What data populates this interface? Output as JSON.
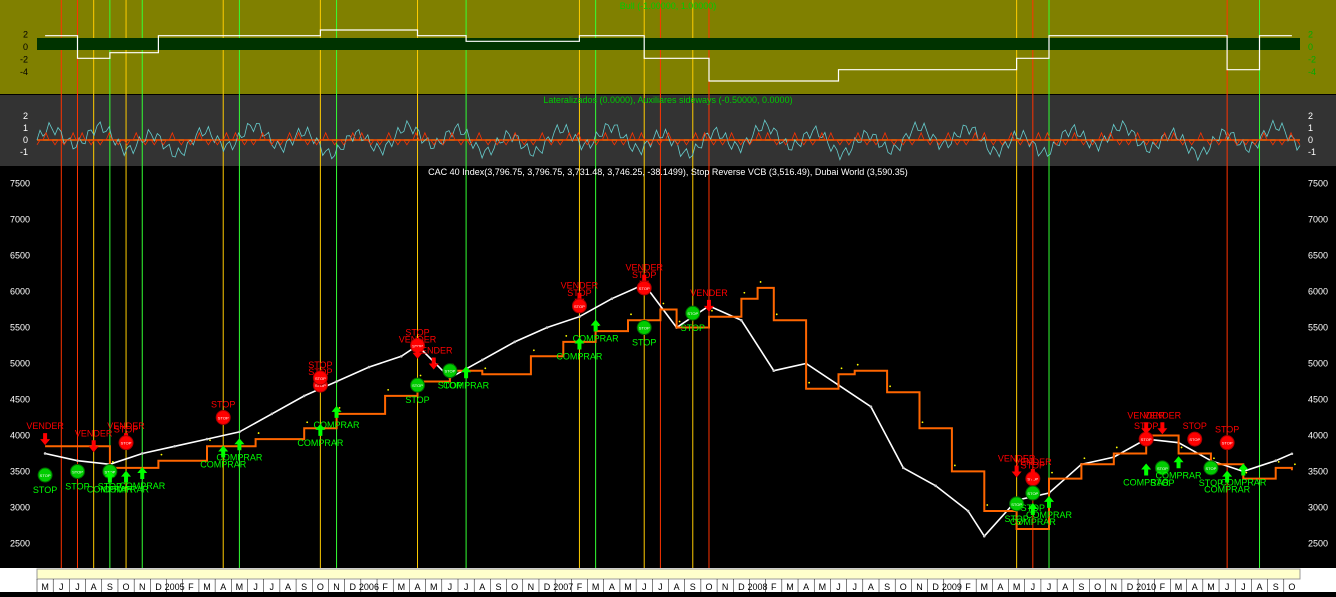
{
  "panels": {
    "top": {
      "title": "Bull (-1.00000, 1.00000)",
      "y_ticks": [
        2,
        0,
        -2,
        -4
      ],
      "colors": {
        "bg": "#808000",
        "band": "#003300",
        "line": "#ffffff",
        "title": "#00cc00"
      }
    },
    "middle": {
      "title": "Lateralizados (0.0000), Auxiliares sideways (-0.50000, 0.0000)",
      "y_ticks": [
        2,
        1,
        0,
        -1
      ],
      "colors": {
        "bg": "#333333",
        "cyan": "#66cccc",
        "red": "#ff3300",
        "zero": "#ff6600",
        "title": "#00cc00"
      }
    },
    "main": {
      "title": "CAC 40 Index(3,796.75, 3,796.75, 3,731.48, 3,746.25, -38.1499), Stop Reverse VCB (3,516.49), Dubai World (3,590.35)",
      "y_ticks": [
        7500,
        7000,
        6500,
        6000,
        5500,
        5000,
        4500,
        4000,
        3500,
        3000,
        2500
      ],
      "colors": {
        "bg": "#000000",
        "price": "#ffffff",
        "stop": "#ff6600",
        "dots": "#ffff00",
        "buy": "#00ff00",
        "sell": "#ff0000",
        "title": "#ffffff"
      }
    }
  },
  "chart_data": {
    "type": "line",
    "title": "CAC 40 Index(3,796.75, 3,796.75, 3,731.48, 3,746.25, -38.1499), Stop Reverse VCB (3,516.49), Dubai World (3,590.35)",
    "ylim": [
      2200,
      7550
    ],
    "x_range": [
      "2004-05",
      "2010-10"
    ],
    "x_month_labels": [
      "M",
      "J",
      "J",
      "A",
      "S",
      "O",
      "N",
      "D",
      "2005",
      "F",
      "M",
      "A",
      "M",
      "J",
      "J",
      "A",
      "S",
      "O",
      "N",
      "D",
      "2006",
      "F",
      "M",
      "A",
      "M",
      "J",
      "J",
      "A",
      "S",
      "O",
      "N",
      "D",
      "2007",
      "F",
      "M",
      "A",
      "M",
      "J",
      "J",
      "A",
      "S",
      "O",
      "N",
      "D",
      "2008",
      "F",
      "M",
      "A",
      "M",
      "J",
      "J",
      "A",
      "S",
      "O",
      "N",
      "D",
      "2009",
      "F",
      "M",
      "A",
      "M",
      "J",
      "J",
      "A",
      "S",
      "O",
      "N",
      "D",
      "2010",
      "F",
      "M",
      "A",
      "M",
      "J",
      "J",
      "A",
      "S",
      "O"
    ],
    "series": [
      {
        "name": "CAC 40 Index",
        "x": [
          "2004-05",
          "2004-07",
          "2004-09",
          "2004-11",
          "2005-01",
          "2005-03",
          "2005-05",
          "2005-07",
          "2005-09",
          "2005-11",
          "2006-01",
          "2006-03",
          "2006-04",
          "2006-06",
          "2006-08",
          "2006-10",
          "2006-12",
          "2007-02",
          "2007-04",
          "2007-06",
          "2007-08",
          "2007-10",
          "2007-12",
          "2008-02",
          "2008-04",
          "2008-06",
          "2008-08",
          "2008-10",
          "2008-12",
          "2009-02",
          "2009-03",
          "2009-05",
          "2009-07",
          "2009-09",
          "2009-11",
          "2010-01",
          "2010-03",
          "2010-05",
          "2010-07",
          "2010-09",
          "2010-10"
        ],
        "values": [
          3750,
          3650,
          3600,
          3750,
          3850,
          3950,
          4050,
          4300,
          4550,
          4750,
          4950,
          5100,
          5250,
          4800,
          5050,
          5300,
          5500,
          5650,
          5900,
          6100,
          5500,
          5800,
          5600,
          4900,
          5000,
          4700,
          4400,
          3550,
          3300,
          2950,
          2600,
          3100,
          3200,
          3600,
          3700,
          3950,
          3900,
          3650,
          3500,
          3650,
          3746
        ]
      },
      {
        "name": "Stop Reverse VCB",
        "x": [
          "2004-05",
          "2004-09",
          "2004-12",
          "2005-03",
          "2005-06",
          "2005-09",
          "2005-11",
          "2006-02",
          "2006-04",
          "2006-06",
          "2006-08",
          "2006-11",
          "2007-01",
          "2007-03",
          "2007-05",
          "2007-07",
          "2007-08",
          "2007-10",
          "2007-12",
          "2008-01",
          "2008-02",
          "2008-04",
          "2008-06",
          "2008-07",
          "2008-09",
          "2008-11",
          "2009-01",
          "2009-03",
          "2009-05",
          "2009-07",
          "2009-09",
          "2009-11",
          "2010-01",
          "2010-03",
          "2010-05",
          "2010-07",
          "2010-09",
          "2010-10"
        ],
        "values": [
          3850,
          3550,
          3650,
          3850,
          3950,
          4100,
          4300,
          4550,
          4750,
          4900,
          4850,
          5100,
          5300,
          5450,
          5600,
          5750,
          5500,
          5650,
          5900,
          6050,
          5600,
          4650,
          4850,
          4900,
          4600,
          4100,
          3500,
          2950,
          2700,
          3400,
          3600,
          3750,
          4000,
          3750,
          3600,
          3400,
          3550,
          3516
        ]
      }
    ],
    "signals": [
      {
        "label": "VENDER",
        "type": "sell",
        "x": "2004-05",
        "y": 3950
      },
      {
        "label": "STOP",
        "type": "stop_green",
        "x": "2004-05",
        "y": 3450
      },
      {
        "label": "VENDER",
        "type": "sell",
        "x": "2004-08",
        "y": 3850
      },
      {
        "label": "STOP",
        "type": "stop_green",
        "x": "2004-07",
        "y": 3500
      },
      {
        "label": "STOP",
        "type": "stop_green",
        "x": "2004-09",
        "y": 3500
      },
      {
        "label": "COMPRAR",
        "type": "buy",
        "x": "2004-09",
        "y": 3400
      },
      {
        "label": "COMPRAR",
        "type": "buy",
        "x": "2004-10",
        "y": 3400
      },
      {
        "label": "COMPRAR",
        "type": "buy",
        "x": "2004-11",
        "y": 3450
      },
      {
        "label": "VENDER",
        "type": "sell",
        "x": "2004-10",
        "y": 3950
      },
      {
        "label": "STOP",
        "type": "stop_red",
        "x": "2004-10",
        "y": 3900
      },
      {
        "label": "COMPRAR",
        "type": "buy",
        "x": "2005-04",
        "y": 3750
      },
      {
        "label": "COMPRAR",
        "type": "buy",
        "x": "2005-05",
        "y": 3850
      },
      {
        "label": "STOP",
        "type": "stop_red",
        "x": "2005-04",
        "y": 4250
      },
      {
        "label": "STOP",
        "type": "stop_red",
        "x": "2005-10",
        "y": 4700
      },
      {
        "label": "STOP",
        "type": "stop_red",
        "x": "2005-10",
        "y": 4800
      },
      {
        "label": "COMPRAR",
        "type": "buy",
        "x": "2005-10",
        "y": 4050
      },
      {
        "label": "COMPRAR",
        "type": "buy",
        "x": "2005-11",
        "y": 4300
      },
      {
        "label": "STOP",
        "type": "stop_red",
        "x": "2006-04",
        "y": 5250
      },
      {
        "label": "VENDER",
        "type": "sell",
        "x": "2006-04",
        "y": 5150
      },
      {
        "label": "VENDER",
        "type": "sell",
        "x": "2006-05",
        "y": 5000
      },
      {
        "label": "STOP",
        "type": "stop_green",
        "x": "2006-04",
        "y": 4700
      },
      {
        "label": "STOP",
        "type": "stop_green",
        "x": "2006-06",
        "y": 4900
      },
      {
        "label": "COMPRAR",
        "type": "buy",
        "x": "2006-07",
        "y": 4850
      },
      {
        "label": "VENDER",
        "type": "sell",
        "x": "2007-02",
        "y": 5900
      },
      {
        "label": "STOP",
        "type": "stop_red",
        "x": "2007-02",
        "y": 5800
      },
      {
        "label": "COMPRAR",
        "type": "buy",
        "x": "2007-02",
        "y": 5250
      },
      {
        "label": "COMPRAR",
        "type": "buy",
        "x": "2007-03",
        "y": 5500
      },
      {
        "label": "VENDER",
        "type": "sell",
        "x": "2007-06",
        "y": 6150
      },
      {
        "label": "STOP",
        "type": "stop_red",
        "x": "2007-06",
        "y": 6050
      },
      {
        "label": "STOP",
        "type": "stop_green",
        "x": "2007-06",
        "y": 5500
      },
      {
        "label": "STOP",
        "type": "stop_green",
        "x": "2007-09",
        "y": 5700
      },
      {
        "label": "VENDER",
        "type": "sell",
        "x": "2007-10",
        "y": 5800
      },
      {
        "label": "VENDER",
        "type": "sell",
        "x": "2009-05",
        "y": 3500
      },
      {
        "label": "STOP",
        "type": "stop_red",
        "x": "2009-06",
        "y": 3400
      },
      {
        "label": "VENDER",
        "type": "sell",
        "x": "2009-06",
        "y": 3450
      },
      {
        "label": "STOP",
        "type": "stop_green",
        "x": "2009-05",
        "y": 3050
      },
      {
        "label": "COMPRAR",
        "type": "buy",
        "x": "2009-06",
        "y": 2950
      },
      {
        "label": "COMPRAR",
        "type": "buy",
        "x": "2009-07",
        "y": 3050
      },
      {
        "label": "STOP",
        "type": "stop_green",
        "x": "2009-06",
        "y": 3200
      },
      {
        "label": "STOP",
        "type": "stop_red",
        "x": "2010-01",
        "y": 3950
      },
      {
        "label": "VENDER",
        "type": "sell",
        "x": "2010-01",
        "y": 4100
      },
      {
        "label": "VENDER",
        "type": "sell",
        "x": "2010-02",
        "y": 4100
      },
      {
        "label": "STOP",
        "type": "stop_green",
        "x": "2010-02",
        "y": 3550
      },
      {
        "label": "COMPRAR",
        "type": "buy",
        "x": "2010-01",
        "y": 3500
      },
      {
        "label": "COMPRAR",
        "type": "buy",
        "x": "2010-03",
        "y": 3600
      },
      {
        "label": "STOP",
        "type": "stop_red",
        "x": "2010-04",
        "y": 3950
      },
      {
        "label": "STOP",
        "type": "stop_red",
        "x": "2010-06",
        "y": 3900
      },
      {
        "label": "STOP",
        "type": "stop_green",
        "x": "2010-05",
        "y": 3550
      },
      {
        "label": "COMPRAR",
        "type": "buy",
        "x": "2010-06",
        "y": 3400
      },
      {
        "label": "COMPRAR",
        "type": "buy",
        "x": "2010-07",
        "y": 3500
      }
    ],
    "vertical_markers": [
      {
        "x": "2004-06",
        "color": "#ff3300"
      },
      {
        "x": "2004-07",
        "color": "#ff3300"
      },
      {
        "x": "2004-08",
        "color": "#ffcc00"
      },
      {
        "x": "2004-09",
        "color": "#33ff33"
      },
      {
        "x": "2004-10",
        "color": "#ffcc00"
      },
      {
        "x": "2004-11",
        "color": "#33ff33"
      },
      {
        "x": "2005-04",
        "color": "#ffcc00"
      },
      {
        "x": "2005-05",
        "color": "#33ff33"
      },
      {
        "x": "2005-10",
        "color": "#ffcc00"
      },
      {
        "x": "2005-11",
        "color": "#33ff33"
      },
      {
        "x": "2006-04",
        "color": "#ffcc00"
      },
      {
        "x": "2006-07",
        "color": "#33ff33"
      },
      {
        "x": "2007-02",
        "color": "#ffcc00"
      },
      {
        "x": "2007-03",
        "color": "#33ff33"
      },
      {
        "x": "2007-06",
        "color": "#ffcc00"
      },
      {
        "x": "2007-07",
        "color": "#ff3300"
      },
      {
        "x": "2007-09",
        "color": "#ffcc00"
      },
      {
        "x": "2007-10",
        "color": "#ff3300"
      },
      {
        "x": "2009-05",
        "color": "#ffcc00"
      },
      {
        "x": "2009-06",
        "color": "#ff3300"
      },
      {
        "x": "2009-07",
        "color": "#33ff33"
      },
      {
        "x": "2010-06",
        "color": "#ff3300"
      },
      {
        "x": "2010-08",
        "color": "#33ff33"
      }
    ]
  }
}
